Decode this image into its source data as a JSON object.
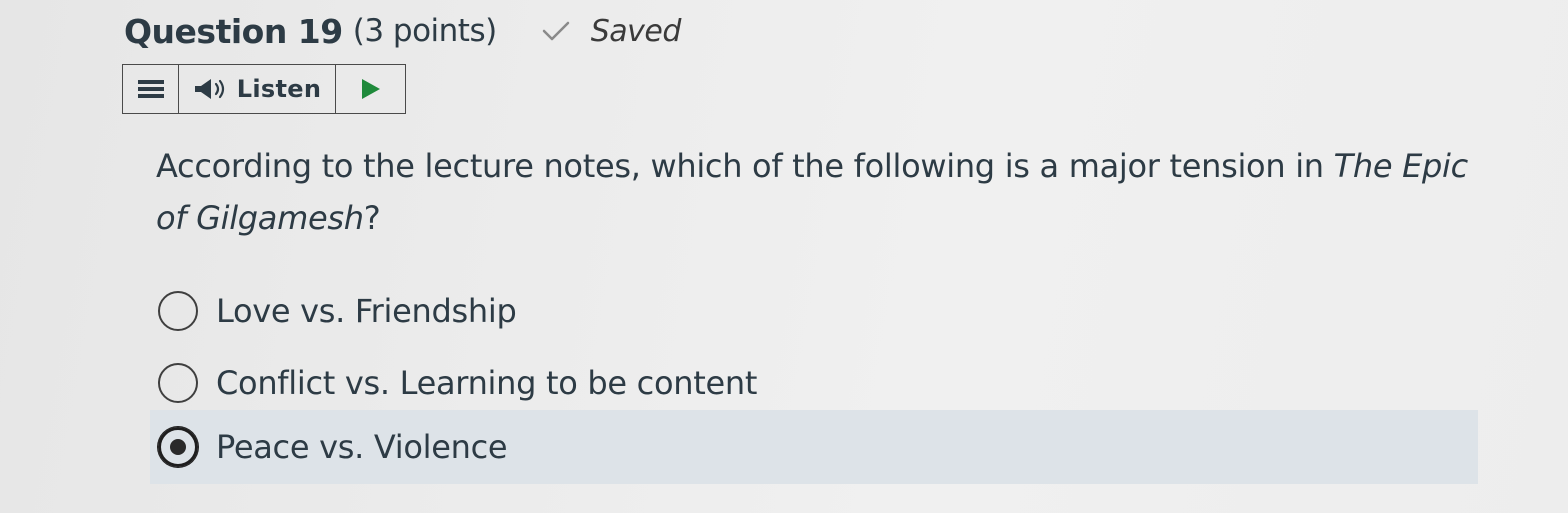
{
  "question": {
    "title": "Question 19",
    "points": "(3 points)",
    "saved_status": "Saved",
    "text_before": "According to the lecture notes, which of the following is a major tension in ",
    "text_title": "The Epic of Gilgamesh",
    "text_after": "?"
  },
  "toolbar": {
    "menu_icon": "hamburger-menu-icon",
    "speaker_icon": "speaker-icon",
    "listen_label": "Listen",
    "play_icon": "play-icon"
  },
  "options": [
    {
      "label": "Love vs. Friendship",
      "selected": false
    },
    {
      "label": "Conflict vs. Learning to be content",
      "selected": false
    },
    {
      "label": "Peace vs. Violence",
      "selected": true
    }
  ],
  "colors": {
    "text": "#2d3b45",
    "selected_row_bg": "#dde3e8",
    "play_green": "#1f8a3b"
  }
}
